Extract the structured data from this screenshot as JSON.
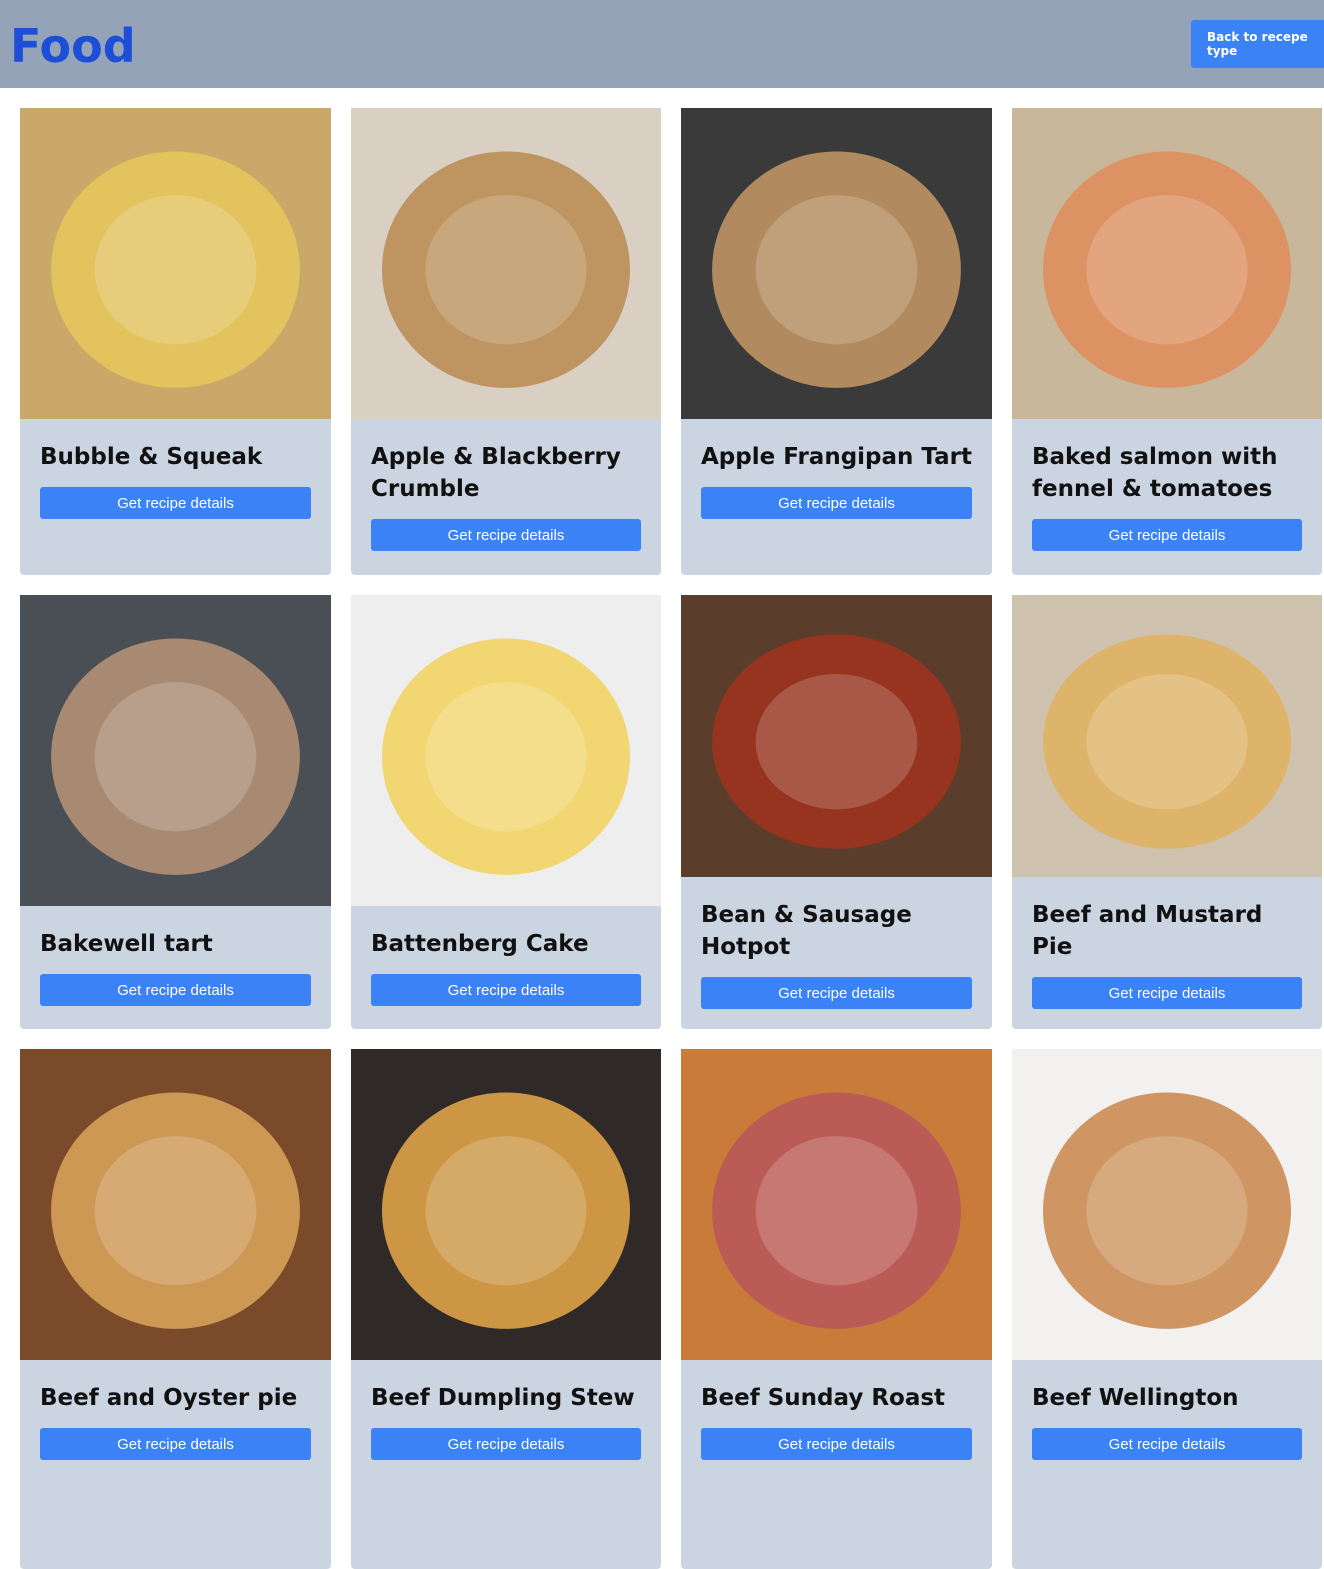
{
  "header": {
    "title": "Food",
    "back_button_label": "Back to recepe type"
  },
  "recipes": [
    {
      "title": "Bubble & Squeak",
      "button": "Get recipe details",
      "image_icon": "bubble-squeak-photo",
      "bg": "#c9a86a",
      "accent": "#e6c85a"
    },
    {
      "title": "Apple & Blackberry Crumble",
      "button": "Get recipe details",
      "image_icon": "crumble-photo",
      "bg": "#d9cfc3",
      "accent": "#b8894f"
    },
    {
      "title": "Apple Frangipan Tart",
      "button": "Get recipe details",
      "image_icon": "frangipan-tart-photo",
      "bg": "#3a3a3a",
      "accent": "#c79a66"
    },
    {
      "title": "Baked salmon with fennel & tomatoes",
      "button": "Get recipe details",
      "image_icon": "salmon-photo",
      "bg": "#c9b79c",
      "accent": "#e08c5a"
    },
    {
      "title": "Bakewell tart",
      "button": "Get recipe details",
      "image_icon": "bakewell-tart-photo",
      "bg": "#4a4f55",
      "accent": "#b89478"
    },
    {
      "title": "Battenberg Cake",
      "button": "Get recipe details",
      "image_icon": "battenberg-cake-photo",
      "bg": "#eeeeee",
      "accent": "#f2d15c"
    },
    {
      "title": "Bean & Sausage Hotpot",
      "button": "Get recipe details",
      "image_icon": "bean-hotpot-photo",
      "bg": "#5b3d2c",
      "accent": "#a2321e"
    },
    {
      "title": "Beef and Mustard Pie",
      "button": "Get recipe details",
      "image_icon": "beef-mustard-pie-photo",
      "bg": "#cfc3b0",
      "accent": "#e0b25e"
    },
    {
      "title": "Beef and Oyster pie",
      "button": "Get recipe details",
      "image_icon": "beef-oyster-pie-photo",
      "bg": "#7a4a2b",
      "accent": "#dca65a"
    },
    {
      "title": "Beef Dumpling Stew",
      "button": "Get recipe details",
      "image_icon": "dumpling-stew-photo",
      "bg": "#2f2a27",
      "accent": "#e7a94b"
    },
    {
      "title": "Beef Sunday Roast",
      "button": "Get recipe details",
      "image_icon": "sunday-roast-photo",
      "bg": "#c97b3a",
      "accent": "#b8565a"
    },
    {
      "title": "Beef Wellington",
      "button": "Get recipe details",
      "image_icon": "beef-wellington-photo",
      "bg": "#f3f1ef",
      "accent": "#c8864a"
    }
  ]
}
